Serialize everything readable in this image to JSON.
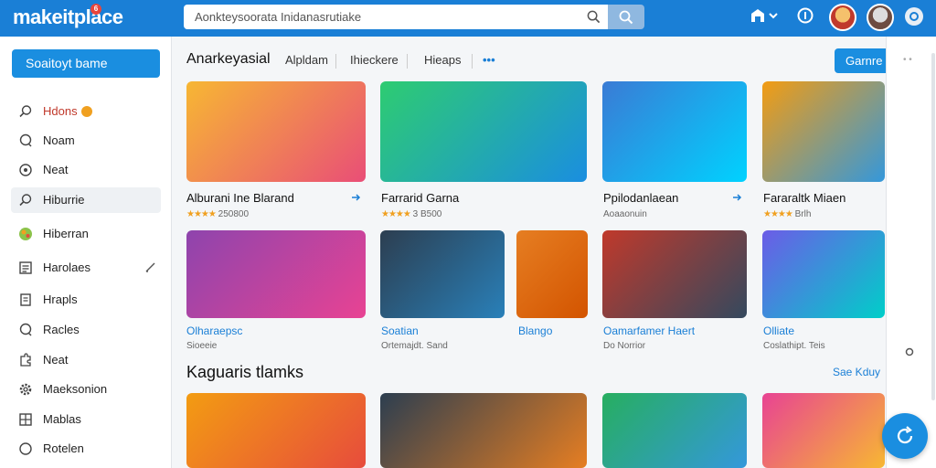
{
  "header": {
    "logo": "makeitplace",
    "logo_badge": "6",
    "search_value": "Aonkteysoorata Inidanasrutiake"
  },
  "sidebar": {
    "primary_button": "Soaitoyt bame",
    "items": [
      {
        "label": "Hdons",
        "icon": "search-icon"
      },
      {
        "label": "Noam",
        "icon": "chat-icon"
      },
      {
        "label": "Neat",
        "icon": "compass-icon"
      },
      {
        "label": "Hiburrie",
        "icon": "search-icon"
      },
      {
        "label": "Hiberran",
        "icon": "globe-icon"
      },
      {
        "label": "Harolaes",
        "icon": "list-icon"
      },
      {
        "label": "Hrapls",
        "icon": "document-icon"
      },
      {
        "label": "Racles",
        "icon": "chat-icon"
      },
      {
        "label": "Neat",
        "icon": "puzzle-icon"
      },
      {
        "label": "Maeksonion",
        "icon": "gear-icon"
      },
      {
        "label": "Mablas",
        "icon": "grid-icon"
      },
      {
        "label": "Rotelen",
        "icon": "circle-icon"
      }
    ]
  },
  "main": {
    "tabs": [
      "Anarkeyasial",
      "Alpldam",
      "Ihieckere",
      "Hieaps"
    ],
    "tabs_more": "•••",
    "games_button": "Garnre",
    "row1": [
      {
        "title": "Alburani Ine Blarand",
        "rating": "★★★★",
        "meta": "250800",
        "colors": [
          "#f7b733",
          "#e94e77"
        ]
      },
      {
        "title": "Farrarid Garna",
        "rating": "★★★★",
        "meta": "3 B500",
        "colors": [
          "#2ecc71",
          "#1a8ee0"
        ]
      },
      {
        "title": "Ppilodanlaean",
        "rating": "",
        "meta": "Aoaaonuin",
        "colors": [
          "#3a7bd5",
          "#00d2ff"
        ]
      },
      {
        "title": "Fararaltk Miaen",
        "rating": "★★★★",
        "meta": "Brlh",
        "colors": [
          "#f39c12",
          "#3498db"
        ]
      }
    ],
    "row2": [
      {
        "title": "Olharaepsc",
        "meta": "Sioeeie",
        "colors": [
          "#8e44ad",
          "#e84393"
        ]
      },
      {
        "title": "Soatian",
        "meta": "Ortemajdt. Sand",
        "colors": [
          "#2c3e50",
          "#2980b9"
        ]
      },
      {
        "title": "Blango",
        "meta": "",
        "colors": [
          "#e67e22",
          "#d35400"
        ]
      },
      {
        "title": "Oamarfamer Haert",
        "meta": "Do Norrior",
        "colors": [
          "#c0392b",
          "#34495e"
        ]
      },
      {
        "title": "Olliate",
        "meta": "Coslathipt. Teis",
        "colors": [
          "#6c5ce7",
          "#00cec9"
        ]
      }
    ],
    "section_title": "Kaguaris tlamks",
    "see_more": "Sae Kduy",
    "row3": [
      {
        "colors": [
          "#f39c12",
          "#e74c3c"
        ]
      },
      {
        "colors": [
          "#2c3e50",
          "#e67e22"
        ]
      },
      {
        "colors": [
          "#27ae60",
          "#3498db"
        ]
      },
      {
        "colors": [
          "#e84393",
          "#f7b733"
        ]
      }
    ]
  }
}
